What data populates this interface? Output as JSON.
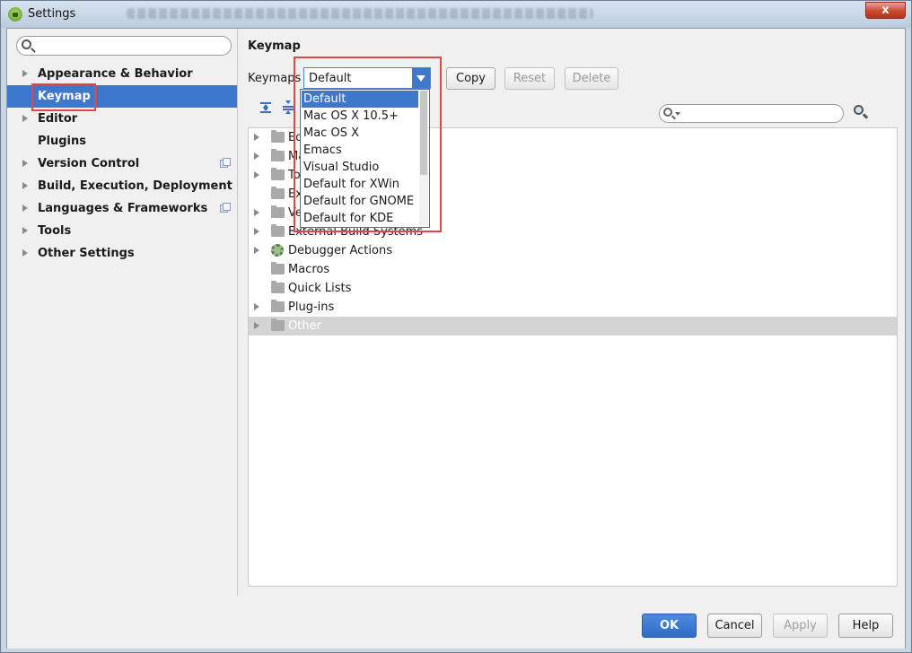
{
  "window": {
    "title": "Settings",
    "close_label": "x"
  },
  "sidebar": {
    "search_placeholder": "",
    "items": [
      {
        "label": "Appearance & Behavior",
        "expandable": true
      },
      {
        "label": "Keymap",
        "expandable": false,
        "selected": true
      },
      {
        "label": "Editor",
        "expandable": true
      },
      {
        "label": "Plugins",
        "expandable": false
      },
      {
        "label": "Version Control",
        "expandable": true
      },
      {
        "label": "Build, Execution, Deployment",
        "expandable": true
      },
      {
        "label": "Languages & Frameworks",
        "expandable": true
      },
      {
        "label": "Tools",
        "expandable": true
      },
      {
        "label": "Other Settings",
        "expandable": true
      }
    ]
  },
  "main": {
    "title": "Keymap",
    "keymaps_label": "Keymaps",
    "keymap_value": "Default",
    "buttons": {
      "copy": "Copy",
      "reset": "Reset",
      "delete": "Delete"
    },
    "filter_placeholder": ""
  },
  "tree": [
    {
      "label": "Ed",
      "icon": "folder-icon"
    },
    {
      "label": "Ma",
      "icon": "folder-icon"
    },
    {
      "label": "To",
      "icon": "folder-icon"
    },
    {
      "label": "Ext",
      "icon": "folder-icon"
    },
    {
      "label": "Ve",
      "icon": "folder-icon"
    },
    {
      "label": "External Build Systems",
      "icon": "folder-icon"
    },
    {
      "label": "Debugger Actions",
      "icon": "gear-icon"
    },
    {
      "label": "Macros",
      "icon": "folder-icon"
    },
    {
      "label": "Quick Lists",
      "icon": "folder-icon"
    },
    {
      "label": "Plug-ins",
      "icon": "folder-icon"
    },
    {
      "label": "Other",
      "icon": "folder-icon"
    }
  ],
  "dropdown_options": [
    "Default",
    "Mac OS X 10.5+",
    "Mac OS X",
    "Emacs",
    "Visual Studio",
    "Default for XWin",
    "Default for GNOME",
    "Default for KDE"
  ],
  "footer": {
    "ok": "OK",
    "cancel": "Cancel",
    "apply": "Apply",
    "help": "Help"
  },
  "colors": {
    "accent": "#3d78cc",
    "highlight_box": "#e04848"
  }
}
